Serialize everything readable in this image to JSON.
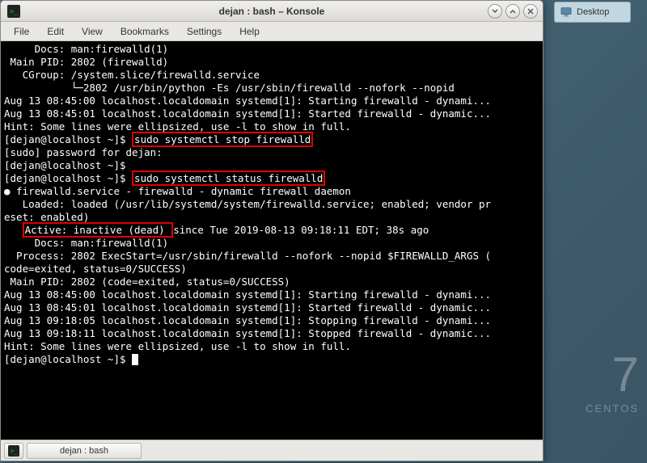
{
  "desktop": {
    "icon_label": "Desktop",
    "watermark_number": "7",
    "watermark_text": "CENTOS"
  },
  "window": {
    "title": "dejan : bash – Konsole"
  },
  "menubar": {
    "items": [
      "File",
      "Edit",
      "View",
      "Bookmarks",
      "Settings",
      "Help"
    ]
  },
  "terminal": {
    "lines": [
      "     Docs: man:firewalld(1)",
      " Main PID: 2802 (firewalld)",
      "   CGroup: /system.slice/firewalld.service",
      "           └─2802 /usr/bin/python -Es /usr/sbin/firewalld --nofork --nopid",
      "",
      "Aug 13 08:45:00 localhost.localdomain systemd[1]: Starting firewalld - dynami...",
      "Aug 13 08:45:01 localhost.localdomain systemd[1]: Started firewalld - dynamic...",
      "Hint: Some lines were ellipsized, use -l to show in full."
    ],
    "prompt1": "[dejan@localhost ~]$ ",
    "cmd_stop": "sudo systemctl stop firewalld",
    "sudo_line": "[sudo] password for dejan:",
    "prompt2": "[dejan@localhost ~]$",
    "prompt3": "[dejan@localhost ~]$ ",
    "cmd_status": "sudo systemctl status firewalld",
    "status_block": [
      "● firewalld.service - firewalld - dynamic firewall daemon",
      "   Loaded: loaded (/usr/lib/systemd/system/firewalld.service; enabled; vendor pr",
      "eset: enabled)"
    ],
    "active_prefix": "   ",
    "active_boxed": "Active: inactive (dead) ",
    "active_suffix": "since Tue 2019-08-13 09:18:11 EDT; 38s ago",
    "docs_line": "     Docs: man:firewalld(1)",
    "process_block": [
      "  Process: 2802 ExecStart=/usr/sbin/firewalld --nofork --nopid $FIREWALLD_ARGS (",
      "code=exited, status=0/SUCCESS)",
      " Main PID: 2802 (code=exited, status=0/SUCCESS)",
      "",
      "Aug 13 08:45:00 localhost.localdomain systemd[1]: Starting firewalld - dynami...",
      "Aug 13 08:45:01 localhost.localdomain systemd[1]: Started firewalld - dynamic...",
      "Aug 13 09:18:05 localhost.localdomain systemd[1]: Stopping firewalld - dynami...",
      "Aug 13 09:18:11 localhost.localdomain systemd[1]: Stopped firewalld - dynamic...",
      "Hint: Some lines were ellipsized, use -l to show in full."
    ],
    "prompt_final": "[dejan@localhost ~]$ "
  },
  "tabbar": {
    "tab_label": "dejan : bash"
  }
}
